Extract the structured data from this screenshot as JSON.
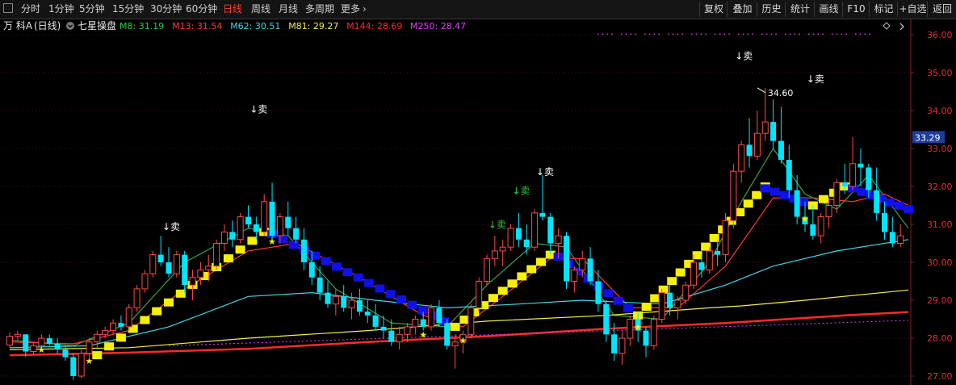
{
  "toolbar": {
    "period_tabs": [
      {
        "label": "分时",
        "active": false
      },
      {
        "label": "1分钟",
        "active": false
      },
      {
        "label": "5分钟",
        "active": false
      },
      {
        "label": "15分钟",
        "active": false
      },
      {
        "label": "30分钟",
        "active": false
      },
      {
        "label": "60分钟",
        "active": false
      },
      {
        "label": "日线",
        "active": true
      },
      {
        "label": "周线",
        "active": false
      },
      {
        "label": "月线",
        "active": false
      },
      {
        "label": "多周期",
        "active": false
      },
      {
        "label": "更多",
        "active": false
      }
    ],
    "right_buttons": [
      "复权",
      "叠加",
      "历史",
      "统计",
      "画线",
      "F10",
      "标记",
      "+自选",
      "返回"
    ]
  },
  "header": {
    "stock": "万 科A",
    "period": "(日线)",
    "indicator": "七星操盘"
  },
  "legend": [
    {
      "label": "M8: 31.19",
      "color": "#2ecc40"
    },
    {
      "label": "M13: 31.54",
      "color": "#ff3b30"
    },
    {
      "label": "M62: 30.51",
      "color": "#3fd6e8"
    },
    {
      "label": "M81: 29.27",
      "color": "#f5f04a"
    },
    {
      "label": "M144: 28.69",
      "color": "#ff2a2a"
    },
    {
      "label": "M250: 28.47",
      "color": "#e040fb"
    }
  ],
  "chart_data": {
    "type": "candlestick",
    "ylim": [
      26.85,
      36.4
    ],
    "y_ticks": [
      "27.00",
      "28.00",
      "29.00",
      "30.00",
      "31.00",
      "32.00",
      "33.00",
      "34.00",
      "35.00",
      "36.00"
    ],
    "current_price": "33.29",
    "high_label": "34.60",
    "high_value": 34.6,
    "candles": [
      [
        27.82,
        28.15,
        27.75,
        28.05
      ],
      [
        28.05,
        28.2,
        27.95,
        28.1
      ],
      [
        28.1,
        28.1,
        27.5,
        27.65
      ],
      [
        27.65,
        27.9,
        27.55,
        27.8
      ],
      [
        27.8,
        28.1,
        27.75,
        28.0
      ],
      [
        28.0,
        28.1,
        27.8,
        27.85
      ],
      [
        27.85,
        28.0,
        27.6,
        27.7
      ],
      [
        27.7,
        27.8,
        27.4,
        27.5
      ],
      [
        27.5,
        27.6,
        26.9,
        27.0
      ],
      [
        27.0,
        27.7,
        26.95,
        27.6
      ],
      [
        27.6,
        28.0,
        27.5,
        27.9
      ],
      [
        27.9,
        28.2,
        27.7,
        28.1
      ],
      [
        28.1,
        28.3,
        28.0,
        28.2
      ],
      [
        28.2,
        28.5,
        28.1,
        28.4
      ],
      [
        28.4,
        28.6,
        28.2,
        28.3
      ],
      [
        28.3,
        28.9,
        28.2,
        28.8
      ],
      [
        28.8,
        29.4,
        28.7,
        29.3
      ],
      [
        29.3,
        29.8,
        29.2,
        29.7
      ],
      [
        29.7,
        30.3,
        29.6,
        30.2
      ],
      [
        30.2,
        30.7,
        29.9,
        30.0
      ],
      [
        30.0,
        30.4,
        29.6,
        29.7
      ],
      [
        29.7,
        30.3,
        29.6,
        30.2
      ],
      [
        30.2,
        30.3,
        29.2,
        29.4
      ],
      [
        29.4,
        29.8,
        29.0,
        29.6
      ],
      [
        29.6,
        30.0,
        29.4,
        29.8
      ],
      [
        29.8,
        30.2,
        29.5,
        29.9
      ],
      [
        29.9,
        30.6,
        29.8,
        30.5
      ],
      [
        30.5,
        31.0,
        30.3,
        30.8
      ],
      [
        30.8,
        31.1,
        30.4,
        30.6
      ],
      [
        30.6,
        31.3,
        30.5,
        31.2
      ],
      [
        31.2,
        31.5,
        30.9,
        31.0
      ],
      [
        31.0,
        31.2,
        30.6,
        30.8
      ],
      [
        30.8,
        31.8,
        30.7,
        31.6
      ],
      [
        31.6,
        32.1,
        30.5,
        30.7
      ],
      [
        30.7,
        31.3,
        30.5,
        31.2
      ],
      [
        31.2,
        31.6,
        30.7,
        30.9
      ],
      [
        30.9,
        31.2,
        30.5,
        30.6
      ],
      [
        30.6,
        30.9,
        29.8,
        30.0
      ],
      [
        30.0,
        30.3,
        29.4,
        29.6
      ],
      [
        29.6,
        29.9,
        29.0,
        29.2
      ],
      [
        29.2,
        29.5,
        28.8,
        28.9
      ],
      [
        28.9,
        29.3,
        28.6,
        29.1
      ],
      [
        29.1,
        29.4,
        28.7,
        28.8
      ],
      [
        28.8,
        29.2,
        28.5,
        29.0
      ],
      [
        29.0,
        29.3,
        28.6,
        28.7
      ],
      [
        28.7,
        29.0,
        28.4,
        28.6
      ],
      [
        28.6,
        28.9,
        28.2,
        28.3
      ],
      [
        28.3,
        28.6,
        28.0,
        28.2
      ],
      [
        28.2,
        28.5,
        27.8,
        27.9
      ],
      [
        27.9,
        28.3,
        27.7,
        28.1
      ],
      [
        28.1,
        28.4,
        27.9,
        28.3
      ],
      [
        28.3,
        28.6,
        28.1,
        28.5
      ],
      [
        28.5,
        28.7,
        28.2,
        28.3
      ],
      [
        28.3,
        28.9,
        28.2,
        28.8
      ],
      [
        28.8,
        29.0,
        28.3,
        28.4
      ],
      [
        28.4,
        28.5,
        27.7,
        27.8
      ],
      [
        27.8,
        28.1,
        27.2,
        27.9
      ],
      [
        27.9,
        28.2,
        27.6,
        28.1
      ],
      [
        28.1,
        28.9,
        28.0,
        28.8
      ],
      [
        28.8,
        29.6,
        28.7,
        29.5
      ],
      [
        29.5,
        30.2,
        29.4,
        30.1
      ],
      [
        30.1,
        30.7,
        29.9,
        30.3
      ],
      [
        30.3,
        30.6,
        29.9,
        30.4
      ],
      [
        30.4,
        31.0,
        30.3,
        30.9
      ],
      [
        30.9,
        31.3,
        30.4,
        30.6
      ],
      [
        30.6,
        31.0,
        30.2,
        30.4
      ],
      [
        30.4,
        31.4,
        30.3,
        31.3
      ],
      [
        31.3,
        32.3,
        31.1,
        31.2
      ],
      [
        31.2,
        31.3,
        30.2,
        30.5
      ],
      [
        30.5,
        30.9,
        30.1,
        30.7
      ],
      [
        30.7,
        30.8,
        29.3,
        29.5
      ],
      [
        29.5,
        29.9,
        29.2,
        29.8
      ],
      [
        29.8,
        30.3,
        29.6,
        30.1
      ],
      [
        30.1,
        30.4,
        29.4,
        29.5
      ],
      [
        29.5,
        29.8,
        28.7,
        28.9
      ],
      [
        28.9,
        29.0,
        27.9,
        28.1
      ],
      [
        28.1,
        28.4,
        27.4,
        27.6
      ],
      [
        27.6,
        28.2,
        27.3,
        28.0
      ],
      [
        28.0,
        28.6,
        27.8,
        28.5
      ],
      [
        28.5,
        28.7,
        27.9,
        28.2
      ],
      [
        28.2,
        28.3,
        27.5,
        27.8
      ],
      [
        27.8,
        28.6,
        27.7,
        28.5
      ],
      [
        28.5,
        29.3,
        28.4,
        29.2
      ],
      [
        29.2,
        29.4,
        28.6,
        28.8
      ],
      [
        28.8,
        29.1,
        28.5,
        29.0
      ],
      [
        29.0,
        29.5,
        28.9,
        29.4
      ],
      [
        29.4,
        30.2,
        29.3,
        30.0
      ],
      [
        30.0,
        30.2,
        29.6,
        29.8
      ],
      [
        29.8,
        30.4,
        29.7,
        30.3
      ],
      [
        30.3,
        30.6,
        29.9,
        30.2
      ],
      [
        30.2,
        31.3,
        30.0,
        31.1
      ],
      [
        31.1,
        32.6,
        30.9,
        32.4
      ],
      [
        32.4,
        33.2,
        32.1,
        33.1
      ],
      [
        33.1,
        33.8,
        32.5,
        32.8
      ],
      [
        32.8,
        34.0,
        32.7,
        33.4
      ],
      [
        33.4,
        34.6,
        33.2,
        33.7
      ],
      [
        33.7,
        34.3,
        33.0,
        33.2
      ],
      [
        33.2,
        34.1,
        32.6,
        32.7
      ],
      [
        32.7,
        33.1,
        31.7,
        31.9
      ],
      [
        31.9,
        32.3,
        31.0,
        31.2
      ],
      [
        31.2,
        31.6,
        30.8,
        31.0
      ],
      [
        31.0,
        31.5,
        30.6,
        30.7
      ],
      [
        30.7,
        31.3,
        30.5,
        31.2
      ],
      [
        31.2,
        31.7,
        30.9,
        31.5
      ],
      [
        31.5,
        32.2,
        31.3,
        32.1
      ],
      [
        32.1,
        32.6,
        31.8,
        32.0
      ],
      [
        32.0,
        33.3,
        31.9,
        32.6
      ],
      [
        32.6,
        33.0,
        32.0,
        32.5
      ],
      [
        32.5,
        32.6,
        31.7,
        31.9
      ],
      [
        31.9,
        32.5,
        31.1,
        31.3
      ],
      [
        31.3,
        31.6,
        30.6,
        30.8
      ],
      [
        30.8,
        31.2,
        30.4,
        30.5
      ],
      [
        30.5,
        31.0,
        30.4,
        30.7
      ]
    ],
    "ma_lines": [
      {
        "name": "M8",
        "color": "#3aa34a",
        "points": [
          [
            0,
            27.95
          ],
          [
            8,
            27.8
          ],
          [
            15,
            28.4
          ],
          [
            22,
            30.0
          ],
          [
            30,
            30.9
          ],
          [
            35,
            30.7
          ],
          [
            41,
            29.3
          ],
          [
            48,
            28.4
          ],
          [
            55,
            28.3
          ],
          [
            60,
            29.4
          ],
          [
            66,
            30.5
          ],
          [
            70,
            30.4
          ],
          [
            76,
            28.6
          ],
          [
            82,
            28.5
          ],
          [
            88,
            30.0
          ],
          [
            92,
            31.6
          ],
          [
            96,
            33.0
          ],
          [
            100,
            31.8
          ],
          [
            104,
            31.4
          ],
          [
            108,
            32.3
          ],
          [
            113,
            30.9
          ]
        ]
      },
      {
        "name": "M13",
        "color": "#ff3b30",
        "points": [
          [
            0,
            27.9
          ],
          [
            8,
            27.85
          ],
          [
            15,
            28.2
          ],
          [
            22,
            29.3
          ],
          [
            30,
            30.3
          ],
          [
            36,
            30.5
          ],
          [
            44,
            29.6
          ],
          [
            52,
            28.6
          ],
          [
            57,
            28.3
          ],
          [
            62,
            29.1
          ],
          [
            68,
            30.1
          ],
          [
            72,
            30.1
          ],
          [
            78,
            28.8
          ],
          [
            84,
            28.8
          ],
          [
            90,
            29.9
          ],
          [
            96,
            31.7
          ],
          [
            101,
            31.7
          ],
          [
            106,
            31.6
          ],
          [
            110,
            31.8
          ],
          [
            113,
            31.5
          ]
        ]
      },
      {
        "name": "M62",
        "color": "#3fd6e8",
        "points": [
          [
            0,
            27.75
          ],
          [
            10,
            27.8
          ],
          [
            20,
            28.3
          ],
          [
            30,
            29.1
          ],
          [
            38,
            29.2
          ],
          [
            46,
            29.0
          ],
          [
            55,
            28.8
          ],
          [
            64,
            28.9
          ],
          [
            72,
            29.0
          ],
          [
            82,
            28.9
          ],
          [
            90,
            29.4
          ],
          [
            96,
            29.9
          ],
          [
            104,
            30.3
          ],
          [
            113,
            30.6
          ]
        ]
      },
      {
        "name": "M81",
        "color": "#f5f04a",
        "points": [
          [
            0,
            27.7
          ],
          [
            15,
            27.75
          ],
          [
            30,
            28.0
          ],
          [
            45,
            28.2
          ],
          [
            60,
            28.45
          ],
          [
            75,
            28.6
          ],
          [
            88,
            28.8
          ],
          [
            92,
            28.85
          ],
          [
            100,
            29.0
          ],
          [
            113,
            29.27
          ]
        ]
      },
      {
        "name": "M144",
        "color": "#ff2a2a",
        "points": [
          [
            0,
            27.55
          ],
          [
            15,
            27.62
          ],
          [
            30,
            27.72
          ],
          [
            45,
            27.9
          ],
          [
            60,
            28.05
          ],
          [
            75,
            28.25
          ],
          [
            90,
            28.4
          ],
          [
            105,
            28.6
          ],
          [
            113,
            28.69
          ]
        ]
      },
      {
        "name": "M250",
        "color": "#e040fb",
        "points": [
          [
            20,
            27.8
          ],
          [
            113,
            28.47
          ]
        ]
      }
    ],
    "signals": [
      {
        "label": "↓卖",
        "x": 20,
        "y": 30.85,
        "color": "#ffffff"
      },
      {
        "label": "↓卖",
        "x": 31,
        "y": 33.95,
        "color": "#ffffff"
      },
      {
        "label": "↓卖",
        "x": 61,
        "y": 30.9,
        "color": "#2ecc40"
      },
      {
        "label": "↓卖",
        "x": 64,
        "y": 31.8,
        "color": "#2ecc40"
      },
      {
        "label": "↓卖",
        "x": 67,
        "y": 32.3,
        "color": "#ffffff"
      },
      {
        "label": "↓卖",
        "x": 92,
        "y": 35.35,
        "color": "#ffffff"
      },
      {
        "label": "↓卖",
        "x": 101,
        "y": 34.75,
        "color": "#ffffff"
      }
    ]
  }
}
